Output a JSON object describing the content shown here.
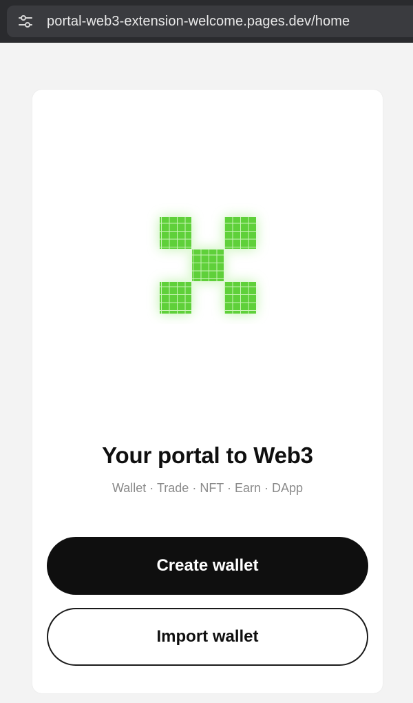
{
  "browser": {
    "url": "portal-web3-extension-welcome.pages.dev/home",
    "site_info_icon": "tune-icon"
  },
  "welcome": {
    "logo_icon": "okx-grid-logo-icon",
    "title": "Your portal to Web3",
    "subtitle": "Wallet · Trade · NFT · Earn · DApp",
    "create_label": "Create wallet",
    "import_label": "Import wallet"
  },
  "colors": {
    "logo_green": "#5fd03a",
    "logo_glow": "#9af07a",
    "primary_button": "#0f0f0f",
    "page_background": "#f3f3f3",
    "topbar": "#2a2b2e"
  }
}
